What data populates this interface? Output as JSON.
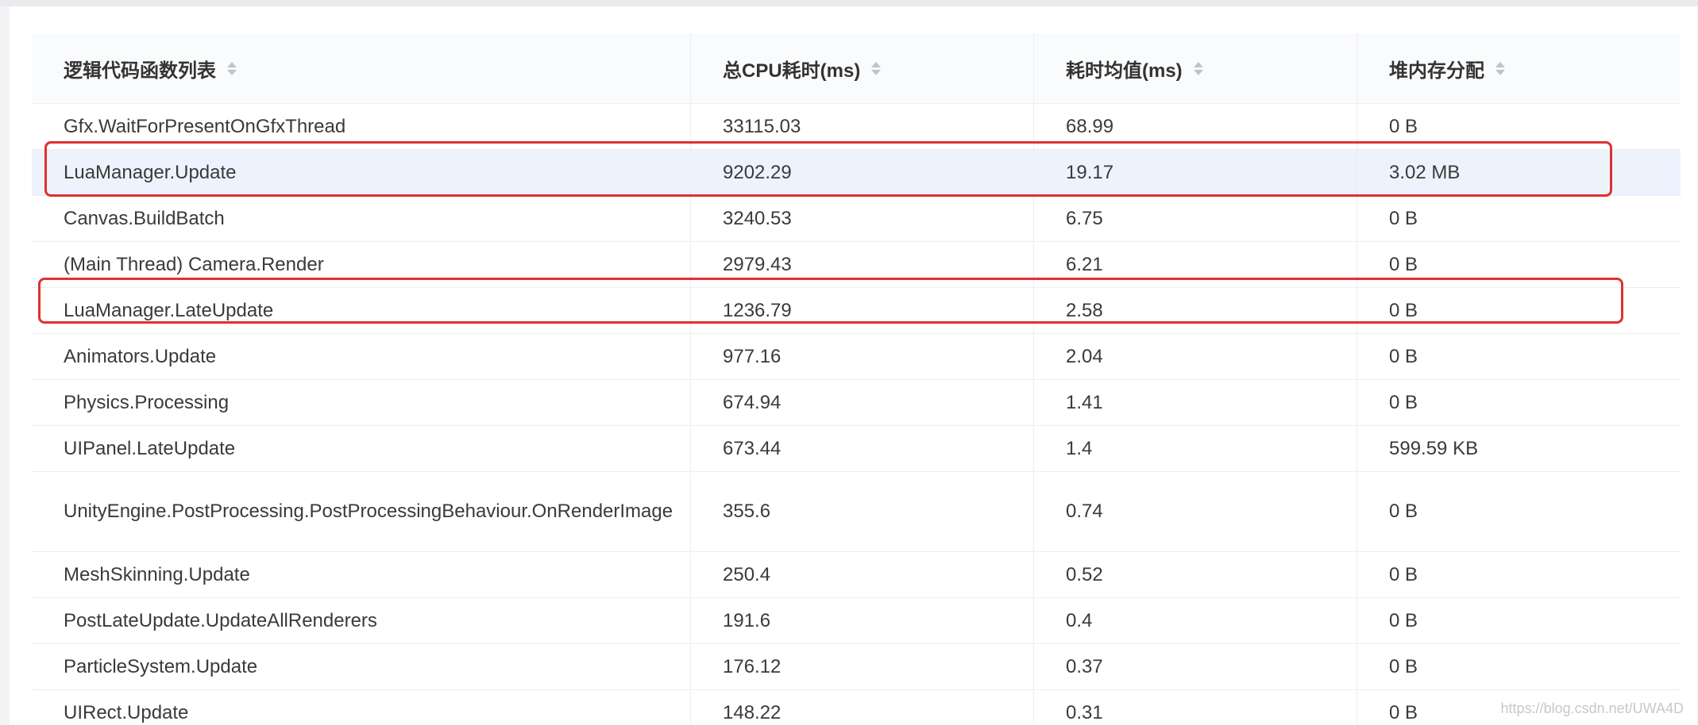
{
  "table": {
    "headers": [
      "逻辑代码函数列表",
      "总CPU耗时(ms)",
      "耗时均值(ms)",
      "堆内存分配"
    ],
    "rows": [
      {
        "name": "Gfx.WaitForPresentOnGfxThread",
        "total": "33115.03",
        "avg": "68.99",
        "heap": "0 B"
      },
      {
        "name": "LuaManager.Update",
        "total": "9202.29",
        "avg": "19.17",
        "heap": "3.02 MB"
      },
      {
        "name": "Canvas.BuildBatch",
        "total": "3240.53",
        "avg": "6.75",
        "heap": "0 B"
      },
      {
        "name": "(Main Thread) Camera.Render",
        "total": "2979.43",
        "avg": "6.21",
        "heap": "0 B"
      },
      {
        "name": "LuaManager.LateUpdate",
        "total": "1236.79",
        "avg": "2.58",
        "heap": "0 B"
      },
      {
        "name": "Animators.Update",
        "total": "977.16",
        "avg": "2.04",
        "heap": "0 B"
      },
      {
        "name": "Physics.Processing",
        "total": "674.94",
        "avg": "1.41",
        "heap": "0 B"
      },
      {
        "name": "UIPanel.LateUpdate",
        "total": "673.44",
        "avg": "1.4",
        "heap": "599.59 KB"
      },
      {
        "name": "UnityEngine.PostProcessing.PostProcessingBehaviour.OnRenderImage",
        "total": "355.6",
        "avg": "0.74",
        "heap": "0 B"
      },
      {
        "name": "MeshSkinning.Update",
        "total": "250.4",
        "avg": "0.52",
        "heap": "0 B"
      },
      {
        "name": "PostLateUpdate.UpdateAllRenderers",
        "total": "191.6",
        "avg": "0.4",
        "heap": "0 B"
      },
      {
        "name": "ParticleSystem.Update",
        "total": "176.12",
        "avg": "0.37",
        "heap": "0 B"
      },
      {
        "name": "UIRect.Update",
        "total": "148.22",
        "avg": "0.31",
        "heap": "0 B"
      }
    ]
  },
  "watermark": "https://blog.csdn.net/UWA4D",
  "colors": {
    "highlight_box": "#e03030",
    "row_highlight": "#edf3fd"
  }
}
